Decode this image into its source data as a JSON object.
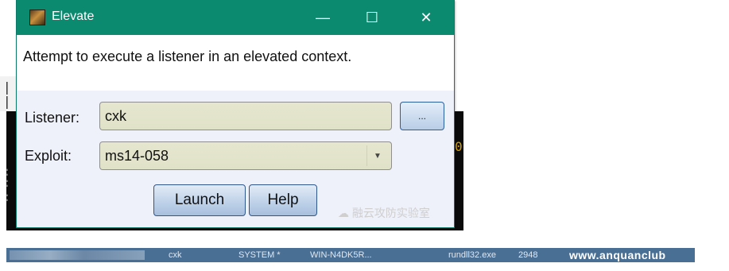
{
  "window": {
    "title": "Elevate",
    "minimize_glyph": "—",
    "maximize_glyph": "☐",
    "close_glyph": "✕"
  },
  "dialog": {
    "description": "Attempt to execute a listener in an elevated context.",
    "listener": {
      "label": "Listener:",
      "value": "cxk",
      "browse_label": "..."
    },
    "exploit": {
      "label": "Exploit:",
      "value": "ms14-058"
    },
    "buttons": {
      "launch": "Launch",
      "help": "Help"
    },
    "watermark": "融云攻防实验室"
  },
  "background": {
    "left_marks": [
      "|",
      "|",
      ":",
      ":",
      ":"
    ],
    "right_mark": "0"
  },
  "session_row": {
    "user": "cxk",
    "privilege": "SYSTEM *",
    "computer": "WIN-N4DK5R...",
    "process": "rundll32.exe",
    "pid": "2948",
    "site_watermark": "www.anquanclub"
  },
  "colors": {
    "titlebar": "#0b8a6f",
    "dialog_bg": "#eef0fa",
    "field_bg": "#e2e4cb",
    "statusbar": "#4a6f94"
  }
}
